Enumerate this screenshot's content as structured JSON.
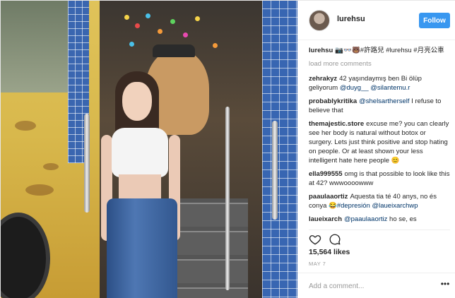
{
  "post": {
    "image_alt_icon": "photo",
    "header": {
      "username": "lurehsu",
      "follow_label": "Follow"
    },
    "caption": {
      "username": "lurehsu",
      "text": "📷👓🐻#許路兒 #lurehsu #月亮公車"
    },
    "load_more_label": "load more comments",
    "comments": [
      {
        "username": "zehrakyz",
        "text_parts": [
          {
            "text": "42 yaşındaymış ben Bi ölüp geliyorum ",
            "link": false
          },
          {
            "text": "@duyg__",
            "link": true
          },
          {
            "text": " ",
            "link": false
          },
          {
            "text": "@silantemu.r",
            "link": true
          }
        ]
      },
      {
        "username": "probablykritika",
        "text_parts": [
          {
            "text": "@shelsartherself",
            "link": true
          },
          {
            "text": " I refuse to believe that",
            "link": false
          }
        ]
      },
      {
        "username": "themajestic.store",
        "text_parts": [
          {
            "text": "excuse me? you can clearly see her body is natural without botox or surgery. Lets just think positive and stop hating on people. Or at least shown your less intelligent hate here people 😊",
            "link": false
          }
        ]
      },
      {
        "username": "ella999555",
        "text_parts": [
          {
            "text": "omg is that possible to look like this at 42? wwwoooowww",
            "link": false
          }
        ]
      },
      {
        "username": "paaulaaortiz",
        "text_parts": [
          {
            "text": "Aquesta tia té 40 anys, no és conya 😂",
            "link": false
          },
          {
            "text": "#depresión",
            "link": true
          },
          {
            "text": " ",
            "link": false
          },
          {
            "text": "@laueixarchwp",
            "link": true
          }
        ]
      },
      {
        "username": "laueixarch",
        "text_parts": [
          {
            "text": "@paaulaaortiz",
            "link": true
          },
          {
            "text": " ho se, es",
            "link": false
          }
        ]
      }
    ],
    "likes_label": "15,564 likes",
    "date_label": "MAY 7",
    "add_comment_placeholder": "Add a comment...",
    "more_icon": "ellipsis-icon",
    "colors": {
      "follow_button": "#3897f0",
      "link": "#003569",
      "muted": "#999999"
    }
  }
}
